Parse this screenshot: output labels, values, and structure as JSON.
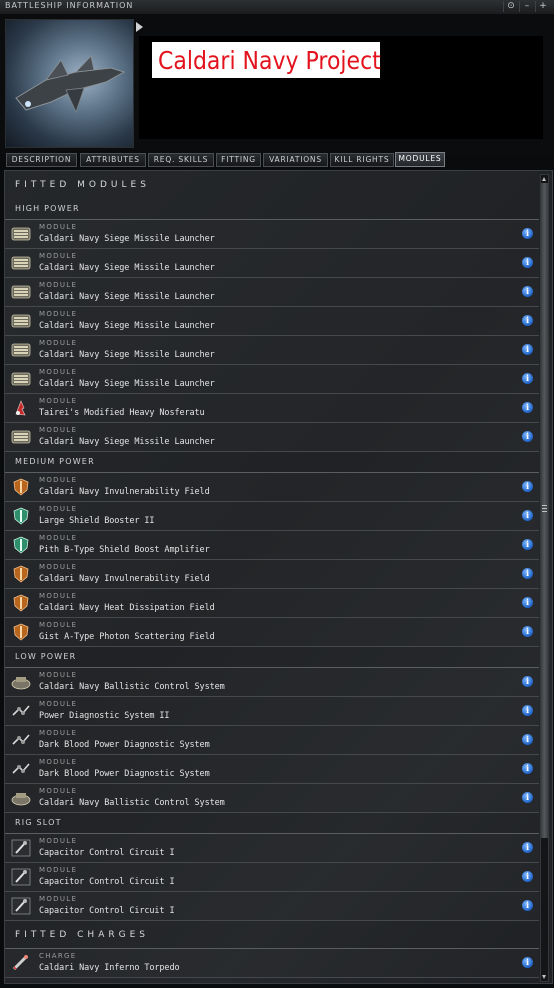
{
  "window": {
    "title": "BATTLESHIP INFORMATION",
    "controls": [
      "⊙",
      "–",
      "+"
    ]
  },
  "ship": {
    "name": "Caldari Navy Project"
  },
  "tabs": [
    {
      "label": "DESCRIPTION",
      "active": false
    },
    {
      "label": "ATTRIBUTES",
      "active": false
    },
    {
      "label": "REQ. SKILLS",
      "active": false
    },
    {
      "label": "FITTING",
      "active": false
    },
    {
      "label": "VARIATIONS",
      "active": false
    },
    {
      "label": "KILL RIGHTS",
      "active": false
    },
    {
      "label": "MODULES",
      "active": true
    }
  ],
  "fitted_modules_title": "FITTED MODULES",
  "groups": [
    {
      "header": "HIGH POWER",
      "items": [
        {
          "kind": "MODULE",
          "name": "Caldari Navy Siege Missile Launcher",
          "icon": "launcher-icon"
        },
        {
          "kind": "MODULE",
          "name": "Caldari Navy Siege Missile Launcher",
          "icon": "launcher-icon"
        },
        {
          "kind": "MODULE",
          "name": "Caldari Navy Siege Missile Launcher",
          "icon": "launcher-icon"
        },
        {
          "kind": "MODULE",
          "name": "Caldari Navy Siege Missile Launcher",
          "icon": "launcher-icon"
        },
        {
          "kind": "MODULE",
          "name": "Caldari Navy Siege Missile Launcher",
          "icon": "launcher-icon"
        },
        {
          "kind": "MODULE",
          "name": "Caldari Navy Siege Missile Launcher",
          "icon": "launcher-icon"
        },
        {
          "kind": "MODULE",
          "name": "Tairei's Modified Heavy Nosferatu",
          "icon": "nosferatu-icon"
        },
        {
          "kind": "MODULE",
          "name": "Caldari Navy Siege Missile Launcher",
          "icon": "launcher-icon"
        }
      ]
    },
    {
      "header": "MEDIUM POWER",
      "items": [
        {
          "kind": "MODULE",
          "name": "Caldari Navy Invulnerability Field",
          "icon": "shield-field-icon"
        },
        {
          "kind": "MODULE",
          "name": "Large Shield Booster II",
          "icon": "shield-booster-icon"
        },
        {
          "kind": "MODULE",
          "name": "Pith B-Type Shield Boost Amplifier",
          "icon": "shield-booster-icon"
        },
        {
          "kind": "MODULE",
          "name": "Caldari Navy Invulnerability Field",
          "icon": "shield-field-icon"
        },
        {
          "kind": "MODULE",
          "name": "Caldari Navy Heat Dissipation Field",
          "icon": "shield-field-icon"
        },
        {
          "kind": "MODULE",
          "name": "Gist A-Type Photon Scattering Field",
          "icon": "shield-field-icon"
        }
      ]
    },
    {
      "header": "LOW POWER",
      "items": [
        {
          "kind": "MODULE",
          "name": "Caldari Navy Ballistic Control System",
          "icon": "ballistic-control-icon"
        },
        {
          "kind": "MODULE",
          "name": "Power Diagnostic System II",
          "icon": "power-diagnostic-icon"
        },
        {
          "kind": "MODULE",
          "name": "Dark Blood Power Diagnostic System",
          "icon": "power-diagnostic-icon"
        },
        {
          "kind": "MODULE",
          "name": "Dark Blood Power Diagnostic System",
          "icon": "power-diagnostic-icon"
        },
        {
          "kind": "MODULE",
          "name": "Caldari Navy Ballistic Control System",
          "icon": "ballistic-control-icon"
        }
      ]
    },
    {
      "header": "RIG SLOT",
      "items": [
        {
          "kind": "MODULE",
          "name": "Capacitor Control Circuit I",
          "icon": "rig-icon"
        },
        {
          "kind": "MODULE",
          "name": "Capacitor Control Circuit I",
          "icon": "rig-icon"
        },
        {
          "kind": "MODULE",
          "name": "Capacitor Control Circuit I",
          "icon": "rig-icon"
        }
      ]
    }
  ],
  "fitted_charges_title": "FITTED CHARGES",
  "charges": [
    {
      "kind": "CHARGE",
      "name": "Caldari Navy Inferno Torpedo",
      "icon": "torpedo-icon"
    }
  ],
  "colors": {
    "ship_name": "#e3131e",
    "info_button": "#1f63c7"
  }
}
